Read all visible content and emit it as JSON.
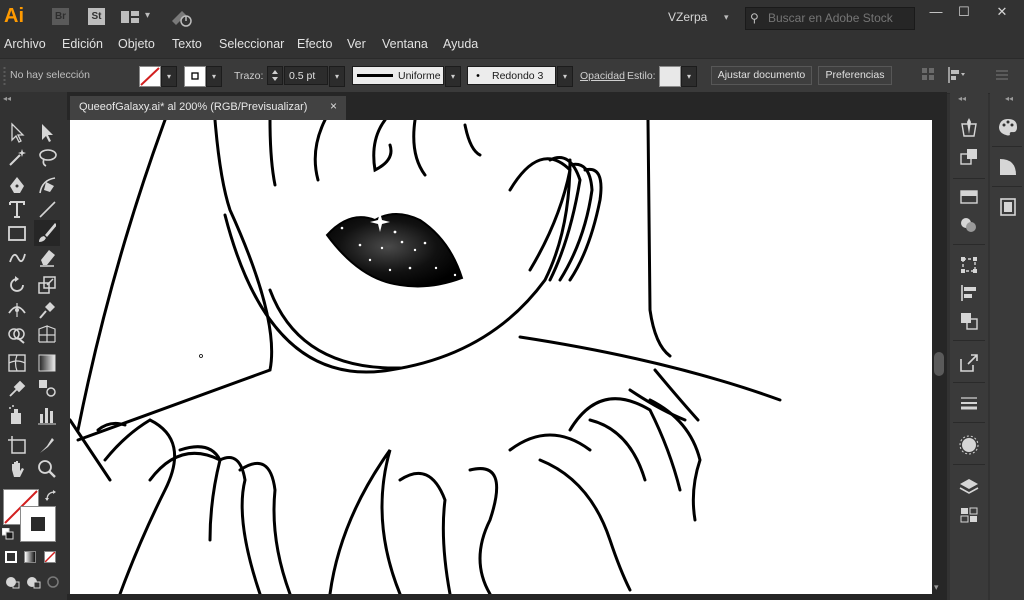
{
  "app": {
    "logo": "Ai",
    "bridge_label": "Br",
    "stock_label": "St",
    "workspace": "VZerpa",
    "search_placeholder": "Buscar en Adobe Stock"
  },
  "menu": [
    "Archivo",
    "Edición",
    "Objeto",
    "Texto",
    "Seleccionar",
    "Efecto",
    "Ver",
    "Ventana",
    "Ayuda"
  ],
  "control_bar": {
    "selection_status": "No hay selección",
    "stroke_label": "Trazo:",
    "stroke_weight": "0.5 pt",
    "stroke_profile": "Uniforme",
    "brush": "Redondo 3 ...",
    "opacity_label": "Opacidad",
    "style_label": "Estilo:",
    "align_doc_button": "Ajustar documento",
    "preferences_button": "Preferencias"
  },
  "document": {
    "tab_title": "QueeofGalaxy.ai* al 200% (RGB/Previsualizar)",
    "close_glyph": "×"
  },
  "colors": {
    "accent_orange": "#ff9a00",
    "ui_dark": "#323232",
    "canvas": "#ffffff",
    "fill_none_slash": "#d22020"
  },
  "icons": {
    "window_minimize": "—",
    "window_maximize": "☐",
    "window_close": "✕",
    "collapse": "◂◂",
    "caret": "▾"
  }
}
